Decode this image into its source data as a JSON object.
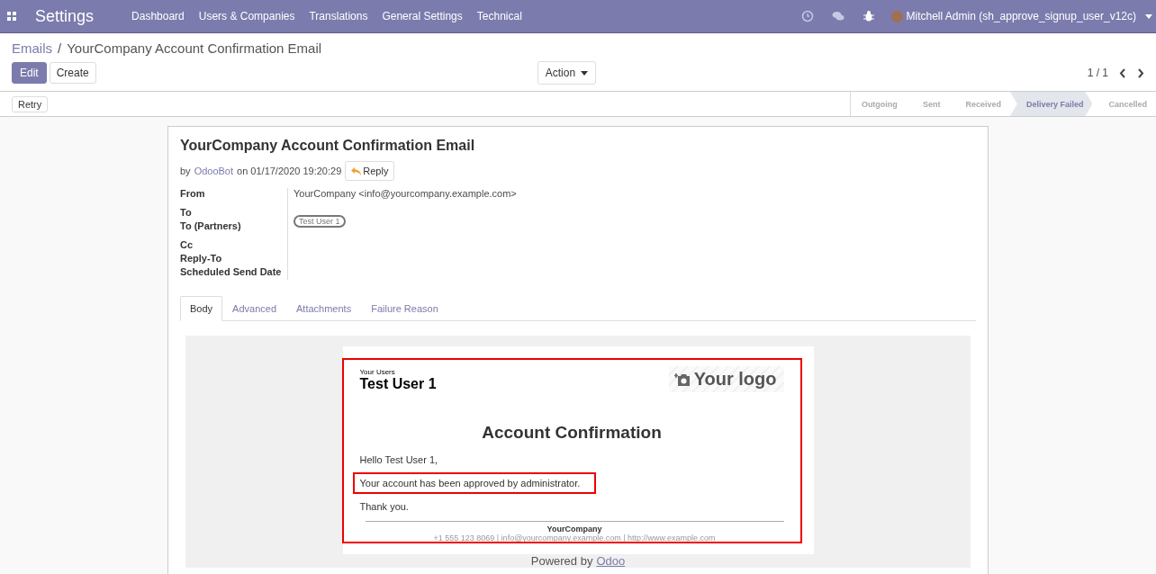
{
  "navbar": {
    "app_title": "Settings",
    "menu": [
      "Dashboard",
      "Users & Companies",
      "Translations",
      "General Settings",
      "Technical"
    ],
    "user": "Mitchell Admin (sh_approve_signup_user_v12c)"
  },
  "breadcrumb": {
    "parent": "Emails",
    "separator": "/",
    "current": "YourCompany Account Confirmation Email"
  },
  "buttons": [
    "Edit",
    "Create"
  ],
  "action": "Action",
  "pager": "1 / 1",
  "retry": "Retry",
  "statusbar": [
    {
      "label": "Outgoing",
      "selected": false
    },
    {
      "label": "Sent",
      "selected": false
    },
    {
      "label": "Received",
      "selected": false
    },
    {
      "label": "Delivery Failed",
      "selected": true
    },
    {
      "label": "Cancelled",
      "selected": false
    }
  ],
  "email": {
    "subject": "YourCompany Account Confirmation Email",
    "by": "by",
    "author": "OdooBot",
    "on": "on 01/17/2020 19:20:29",
    "reply": "Reply",
    "fields": [
      {
        "label": "From",
        "value": "YourCompany <info@yourcompany.example.com>",
        "kind": "text"
      },
      {
        "label": "To",
        "kind": "empty"
      },
      {
        "label": "To (Partners)",
        "value": "Test User 1",
        "kind": "tag"
      },
      {
        "label": "Cc",
        "kind": "empty"
      },
      {
        "label": "Reply-To",
        "kind": "empty"
      },
      {
        "label": "Scheduled Send Date",
        "kind": "empty"
      }
    ],
    "tabs": [
      {
        "label": "Body",
        "selected": true
      },
      {
        "label": "Advanced",
        "selected": false
      },
      {
        "label": "Attachments",
        "selected": false
      },
      {
        "label": "Failure Reason",
        "selected": false
      }
    ]
  },
  "body": {
    "kicker": "Your Users",
    "name": "Test User 1",
    "logo": "Your logo",
    "heading": "Account Confirmation",
    "greeting": "Hello Test User 1,",
    "message": "Your account has been approved by administrator.",
    "closing": "Thank you.",
    "company": "YourCompany",
    "contact": "+1 555 123 8069 | info@yourcompany.example.com | http://www.example.com",
    "powered_by": "Powered by",
    "powered_link": "Odoo"
  }
}
